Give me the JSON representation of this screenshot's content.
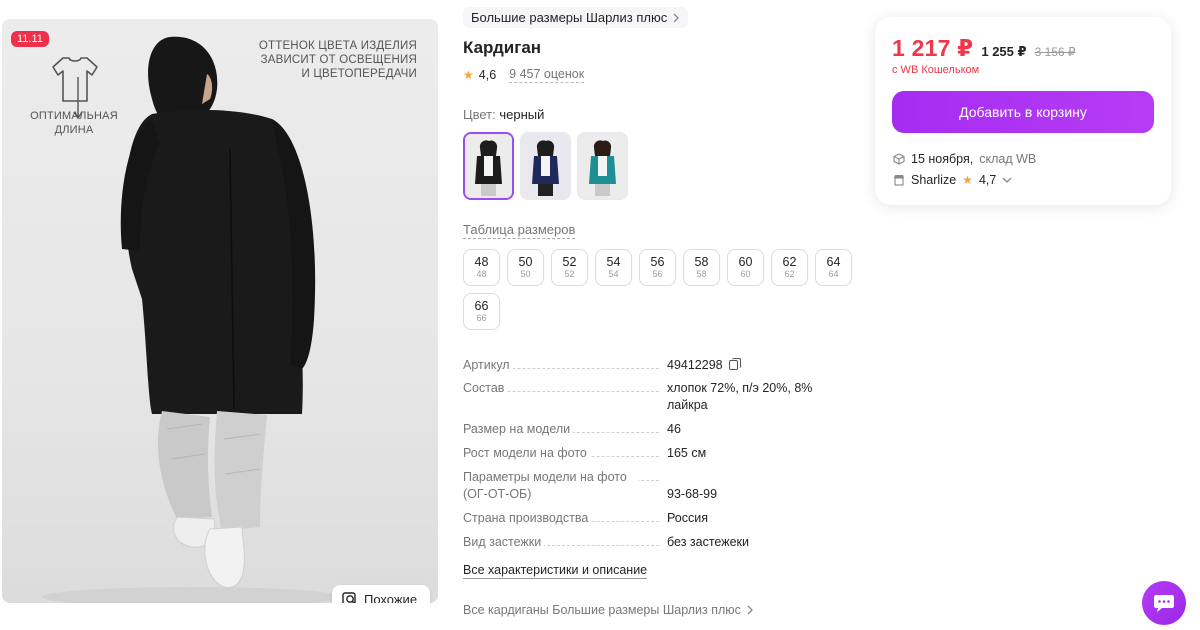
{
  "photo": {
    "promo_badge": "11.11",
    "length_label": "ОПТИМАЛЬНАЯ\nДЛИНА",
    "color_note": "ОТТЕНОК ЦВЕТА ИЗДЕЛИЯ\nЗАВИСИТ ОТ ОСВЕЩЕНИЯ\nИ ЦВЕТОПЕРЕДАЧИ",
    "similar_label": "Похожие",
    "icons": [
      "shirt-icon",
      "arrow-down-icon",
      "search-similar-icon"
    ]
  },
  "product": {
    "brand": "Большие размеры Шарлиз плюс",
    "title": "Кардиган",
    "rating": "4,6",
    "reviews": "9 457 оценок",
    "color_label": "Цвет:",
    "color_value": "черный",
    "thumbnails": [
      {
        "color": "black",
        "active": true
      },
      {
        "color": "navy",
        "active": false
      },
      {
        "color": "teal",
        "active": false
      }
    ],
    "size_table_label": "Таблица размеров",
    "sizes": [
      {
        "ru": "48",
        "orig": "48"
      },
      {
        "ru": "50",
        "orig": "50"
      },
      {
        "ru": "52",
        "orig": "52"
      },
      {
        "ru": "54",
        "orig": "54"
      },
      {
        "ru": "56",
        "orig": "56"
      },
      {
        "ru": "58",
        "orig": "58"
      },
      {
        "ru": "60",
        "orig": "60"
      },
      {
        "ru": "62",
        "orig": "62"
      },
      {
        "ru": "64",
        "orig": "64"
      },
      {
        "ru": "66",
        "orig": "66"
      }
    ],
    "specs": [
      {
        "key": "Артикул",
        "value": "49412298",
        "copy": true
      },
      {
        "key": "Состав",
        "value": "хлопок 72%, п/э 20%, 8% лайкра"
      },
      {
        "key": "Размер на модели",
        "value": "46"
      },
      {
        "key": "Рост модели на фото",
        "value": "165 см"
      },
      {
        "key": "Параметры модели на фото (ОГ-ОТ-ОБ)",
        "value": "93-68-99"
      },
      {
        "key": "Страна производства",
        "value": "Россия"
      },
      {
        "key": "Вид застежки",
        "value": "без застежеки"
      }
    ],
    "all_specs_link": "Все характеристики и описание",
    "all_category_link": "Все кардиганы Большие размеры Шарлиз плюс"
  },
  "buy_card": {
    "price_wallet": "1 217 ₽",
    "price": "1 255 ₽",
    "price_old": "3 156 ₽",
    "wallet_note": "с WB Кошельком",
    "cart_button": "Добавить в корзину",
    "delivery_date": "15 ноября,",
    "delivery_warehouse": "склад WB",
    "seller_name": "Sharlize",
    "seller_rating": "4,7",
    "accent_color": "#a62cf2",
    "price_color": "#f1364a"
  }
}
